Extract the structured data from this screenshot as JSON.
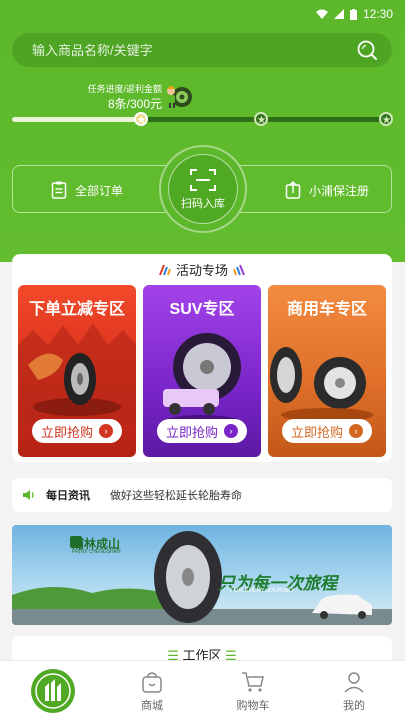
{
  "status_bar": {
    "time": "12:30"
  },
  "search": {
    "placeholder": "输入商品名称/关键字"
  },
  "progress": {
    "label": "任务进度/返利金额",
    "value": "8条/300元",
    "fraction": 0.35
  },
  "actions": {
    "all_orders": "全部订单",
    "scan": "扫码入库",
    "register": "小浦保注册"
  },
  "activity": {
    "title": "活动专场",
    "tiles": [
      {
        "name": "下单立减专区",
        "button": "立即抢购"
      },
      {
        "name": "SUV专区",
        "button": "立即抢购"
      },
      {
        "name": "商用车专区",
        "button": "立即抢购"
      }
    ]
  },
  "news": {
    "label": "每日资讯",
    "text": "做好这些轻松延长轮胎寿命"
  },
  "banner": {
    "brand": "浦林成山",
    "brand_sub": "PRINX CHENGSHAN",
    "slogan": "只为每一次旅程",
    "slogan_sub": "FOR EVERY JOURNEY"
  },
  "workzone": {
    "title": "工作区"
  },
  "nav": {
    "items": [
      {
        "label": "商城"
      },
      {
        "label": "购物车"
      },
      {
        "label": "我的"
      }
    ]
  },
  "colors": {
    "brand_green": "#5cb82a",
    "dark_green": "#2d6f17"
  }
}
